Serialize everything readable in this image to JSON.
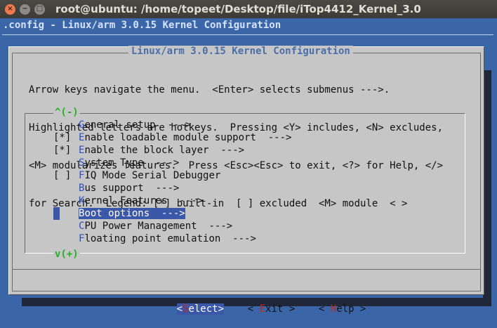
{
  "window": {
    "title": "root@ubuntu: /home/topeet/Desktop/file/iTop4412_Kernel_3.0",
    "close_glyph": "×",
    "min_glyph": "−",
    "max_glyph": "□"
  },
  "app_title": ".config - Linux/arm 3.0.15 Kernel Configuration",
  "dialog": {
    "title": "Linux/arm 3.0.15 Kernel Configuration",
    "help_lines": [
      "Arrow keys navigate the menu.  <Enter> selects submenus --->.",
      "Highlighted letters are hotkeys.  Pressing <Y> includes, <N> excludes,",
      "<M> modularizes features.  Press <Esc><Esc> to exit, <?> for Help, </>",
      "for Search.  Legend: [*] built-in  [ ] excluded  <M> module  < >"
    ],
    "scroll_up": "^(-)",
    "scroll_down": "v(+)"
  },
  "menu_items": [
    {
      "mark": "",
      "hotkey": "G",
      "rest": "eneral setup  --->"
    },
    {
      "mark": "[*]",
      "hotkey": "E",
      "rest": "nable loadable module support  --->"
    },
    {
      "mark": "[*]",
      "hotkey": "E",
      "rest": "nable the block layer  --->"
    },
    {
      "mark": "",
      "hotkey": "S",
      "rest": "ystem Type  --->"
    },
    {
      "mark": "[ ]",
      "hotkey": "F",
      "rest": "IQ Mode Serial Debugger"
    },
    {
      "mark": "",
      "hotkey": "B",
      "rest": "us support  --->"
    },
    {
      "mark": "",
      "hotkey": "K",
      "rest": "ernel Features  --->"
    },
    {
      "mark": "",
      "hotkey": "B",
      "rest": "oot options  --->"
    },
    {
      "mark": "",
      "hotkey": "C",
      "rest": "PU Power Management  --->"
    },
    {
      "mark": "",
      "hotkey": "F",
      "rest": "loating point emulation  --->"
    }
  ],
  "selected_index": 7,
  "buttons": {
    "select": {
      "pre": "<",
      "hotkey": "S",
      "rest": "elect>"
    },
    "exit": {
      "pre": "< ",
      "hotkey": "E",
      "rest": "xit >"
    },
    "help": {
      "pre": "< ",
      "hotkey": "H",
      "rest": "elp >"
    }
  }
}
